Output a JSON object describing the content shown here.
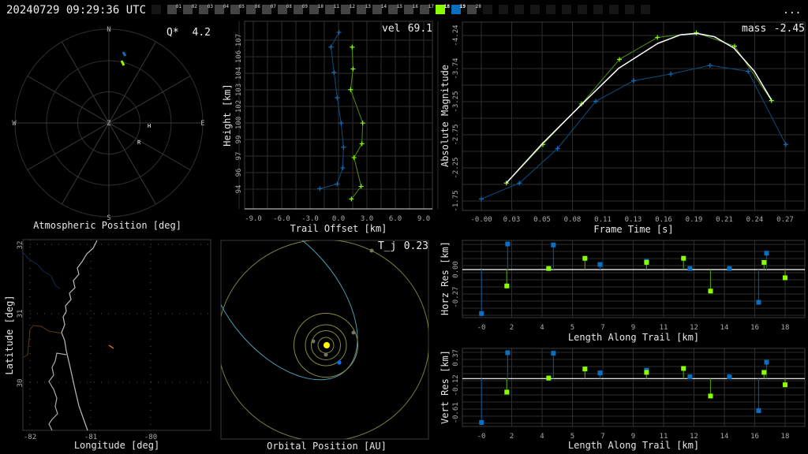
{
  "header": {
    "timestamp": "20240729 09:29:36 UTC",
    "menu": "...",
    "frames": [
      {
        "label": "",
        "state": "dark"
      },
      {
        "label": "01",
        "state": "gray"
      },
      {
        "label": "02",
        "state": "gray"
      },
      {
        "label": "03",
        "state": "gray"
      },
      {
        "label": "04",
        "state": "gray"
      },
      {
        "label": "05",
        "state": "gray"
      },
      {
        "label": "06",
        "state": "gray"
      },
      {
        "label": "07",
        "state": "gray"
      },
      {
        "label": "08",
        "state": "gray"
      },
      {
        "label": "09",
        "state": "gray"
      },
      {
        "label": "10",
        "state": "gray"
      },
      {
        "label": "11",
        "state": "gray"
      },
      {
        "label": "12",
        "state": "gray"
      },
      {
        "label": "13",
        "state": "gray"
      },
      {
        "label": "14",
        "state": "gray"
      },
      {
        "label": "15",
        "state": "gray"
      },
      {
        "label": "16",
        "state": "gray"
      },
      {
        "label": "17",
        "state": "gray"
      },
      {
        "label": "18",
        "state": "green"
      },
      {
        "label": "19",
        "state": "blue"
      },
      {
        "label": "20",
        "state": "gray"
      },
      {
        "label": "",
        "state": "dark"
      },
      {
        "label": "",
        "state": "dark"
      },
      {
        "label": "",
        "state": "dark"
      },
      {
        "label": "",
        "state": "dark"
      },
      {
        "label": "",
        "state": "dark"
      },
      {
        "label": "",
        "state": "dark"
      },
      {
        "label": "",
        "state": "dark"
      },
      {
        "label": "",
        "state": "dark"
      },
      {
        "label": "",
        "state": "dark"
      },
      {
        "label": "",
        "state": "dark"
      },
      {
        "label": "",
        "state": "dark"
      }
    ]
  },
  "colors": {
    "green": "#88ff00",
    "blue": "#0a6fc2",
    "green_line": "#4f8f10",
    "blue_line": "#0b4f80",
    "fit": "#ffffff",
    "grid": "#2e2e2e"
  },
  "polar": {
    "title": "Atmospheric Position [deg]",
    "stat_label": "Q*",
    "stat_value": "4.2",
    "dirs": {
      "n": "N",
      "s": "S",
      "e": "E",
      "w": "W",
      "z": "Z"
    },
    "markers": [
      {
        "label": "H",
        "az": 100,
        "zen": 40
      },
      {
        "label": "R",
        "az": 118,
        "zen": 44
      }
    ]
  },
  "chart_data": [
    {
      "type": "line",
      "title": "Trail Offset",
      "stat_label": "vel",
      "stat_value": "69.1",
      "xlabel": "Trail Offset [km]",
      "ylabel": "Height [km]",
      "xticks": [
        "-9.0",
        "-6.0",
        "-3.0",
        "0.0",
        "3.0",
        "6.0",
        "9.0"
      ],
      "yticks": [
        "107",
        "106",
        "104",
        "103",
        "102",
        "100",
        "99",
        "97",
        "96",
        "94"
      ],
      "xlim": [
        -10,
        10
      ],
      "series": [
        {
          "name": "station-blue",
          "points": [
            [
              0.05,
              107.68
            ],
            [
              -0.8,
              106.4
            ],
            [
              -0.47,
              104.2
            ],
            [
              -0.14,
              102.0
            ],
            [
              0.27,
              99.8
            ],
            [
              0.53,
              97.7
            ],
            [
              0.44,
              95.9
            ],
            [
              -0.14,
              94.5
            ],
            [
              -1.98,
              94.1
            ]
          ]
        },
        {
          "name": "station-green",
          "points": [
            [
              1.44,
              106.4
            ],
            [
              1.53,
              104.5
            ],
            [
              1.28,
              102.7
            ],
            [
              2.56,
              99.8
            ],
            [
              2.47,
              98.0
            ],
            [
              1.64,
              96.8
            ],
            [
              2.39,
              94.3
            ],
            [
              1.36,
              93.2
            ]
          ]
        }
      ]
    },
    {
      "type": "line",
      "title": "Light Curve",
      "stat_label": "mass",
      "stat_value": "-2.45",
      "xlabel": "Frame Time [s]",
      "ylabel": "Absolute Magnitude",
      "xticks": [
        "-0.00",
        "0.03",
        "0.05",
        "0.08",
        "0.11",
        "0.13",
        "0.16",
        "0.19",
        "0.21",
        "0.24",
        "0.27"
      ],
      "yticks": [
        "-4.24",
        "-3.74",
        "-3.25",
        "-2.75",
        "-2.25",
        "-1.75"
      ],
      "series": [
        {
          "name": "station-blue",
          "points": [
            [
              0,
              -1.78
            ],
            [
              0.0335,
              -2.02
            ],
            [
              0.067,
              -2.54
            ],
            [
              0.1006,
              -3.25
            ],
            [
              0.134,
              -3.56
            ],
            [
              0.1665,
              -3.66
            ],
            [
              0.201,
              -3.79
            ],
            [
              0.2345,
              -3.7
            ],
            [
              0.2676,
              -2.6
            ]
          ]
        },
        {
          "name": "station-green",
          "points": [
            [
              0.022,
              -2.02
            ],
            [
              0.0541,
              -2.6
            ],
            [
              0.0881,
              -3.21
            ],
            [
              0.1214,
              -3.88
            ],
            [
              0.1548,
              -4.21
            ],
            [
              0.189,
              -4.28
            ],
            [
              0.2226,
              -4.08
            ],
            [
              0.255,
              -3.26
            ]
          ]
        },
        {
          "name": "fit",
          "points": [
            [
              0.022,
              -2.02
            ],
            [
              0.054,
              -2.62
            ],
            [
              0.088,
              -3.2
            ],
            [
              0.121,
              -3.75
            ],
            [
              0.155,
              -4.12
            ],
            [
              0.175,
              -4.25
            ],
            [
              0.19,
              -4.27
            ],
            [
              0.205,
              -4.22
            ],
            [
              0.222,
              -4.05
            ],
            [
              0.24,
              -3.7
            ],
            [
              0.255,
              -3.27
            ]
          ]
        }
      ]
    },
    {
      "type": "scatter",
      "title": "Horizontal Residuals",
      "xlabel": "Length Along Trail [km]",
      "ylabel": "Horz Res [km]",
      "xticks": [
        "-0",
        "2",
        "4",
        "5",
        "7",
        "9",
        "11",
        "12",
        "14",
        "16",
        "18"
      ],
      "yticks": [
        {
          "v": 0.0,
          "label": "0.00"
        },
        {
          "v": -0.27,
          "label": "-0.27"
        }
      ],
      "series": [
        {
          "name": "station-blue",
          "points": [
            [
              0.01,
              -0.43
            ],
            [
              1.56,
              0.25
            ],
            [
              4.27,
              0.24
            ],
            [
              7.03,
              0.05
            ],
            [
              9.79,
              0.08
            ],
            [
              12.36,
              0.01
            ],
            [
              14.7,
              0.01
            ],
            [
              16.43,
              -0.32
            ],
            [
              16.9,
              0.16
            ]
          ]
        },
        {
          "name": "station-green",
          "points": [
            [
              1.51,
              -0.16
            ],
            [
              3.99,
              0.01
            ],
            [
              6.14,
              0.11
            ],
            [
              9.79,
              0.07
            ],
            [
              11.98,
              0.11
            ],
            [
              13.58,
              -0.21
            ],
            [
              16.75,
              0.07
            ],
            [
              18.0,
              -0.08
            ]
          ]
        }
      ]
    },
    {
      "type": "scatter",
      "title": "Vertical Residuals",
      "xlabel": "Length Along Trail [km]",
      "ylabel": "Vert Res [km]",
      "xticks": [
        "-0",
        "2",
        "4",
        "5",
        "7",
        "9",
        "11",
        "12",
        "14",
        "16",
        "18"
      ],
      "yticks": [
        {
          "v": 0.37,
          "label": "0.37"
        },
        {
          "v": -0.12,
          "label": "-0.12"
        },
        {
          "v": -0.61,
          "label": "-0.61"
        }
      ],
      "series": [
        {
          "name": "station-blue",
          "points": [
            [
              0.01,
              -0.78
            ],
            [
              1.56,
              0.46
            ],
            [
              4.27,
              0.45
            ],
            [
              7.03,
              0.1
            ],
            [
              9.79,
              0.15
            ],
            [
              12.36,
              0.03
            ],
            [
              14.7,
              0.03
            ],
            [
              16.43,
              -0.57
            ],
            [
              16.9,
              0.29
            ]
          ]
        },
        {
          "name": "station-green",
          "points": [
            [
              1.51,
              -0.24
            ],
            [
              3.99,
              0.01
            ],
            [
              6.14,
              0.17
            ],
            [
              9.79,
              0.11
            ],
            [
              11.98,
              0.18
            ],
            [
              13.58,
              -0.31
            ],
            [
              16.75,
              0.11
            ],
            [
              18.0,
              -0.11
            ]
          ]
        }
      ]
    }
  ],
  "map": {
    "xlabel": "Longitude [deg]",
    "ylabel": "Latitude [deg]",
    "xticks": [
      "-82",
      "-81",
      "-80"
    ],
    "yticks": [
      "32",
      "31",
      "30"
    ]
  },
  "orbit": {
    "xlabel": "Orbital Position [AU]",
    "stat_label": "T_j",
    "stat_value": "0.23"
  }
}
